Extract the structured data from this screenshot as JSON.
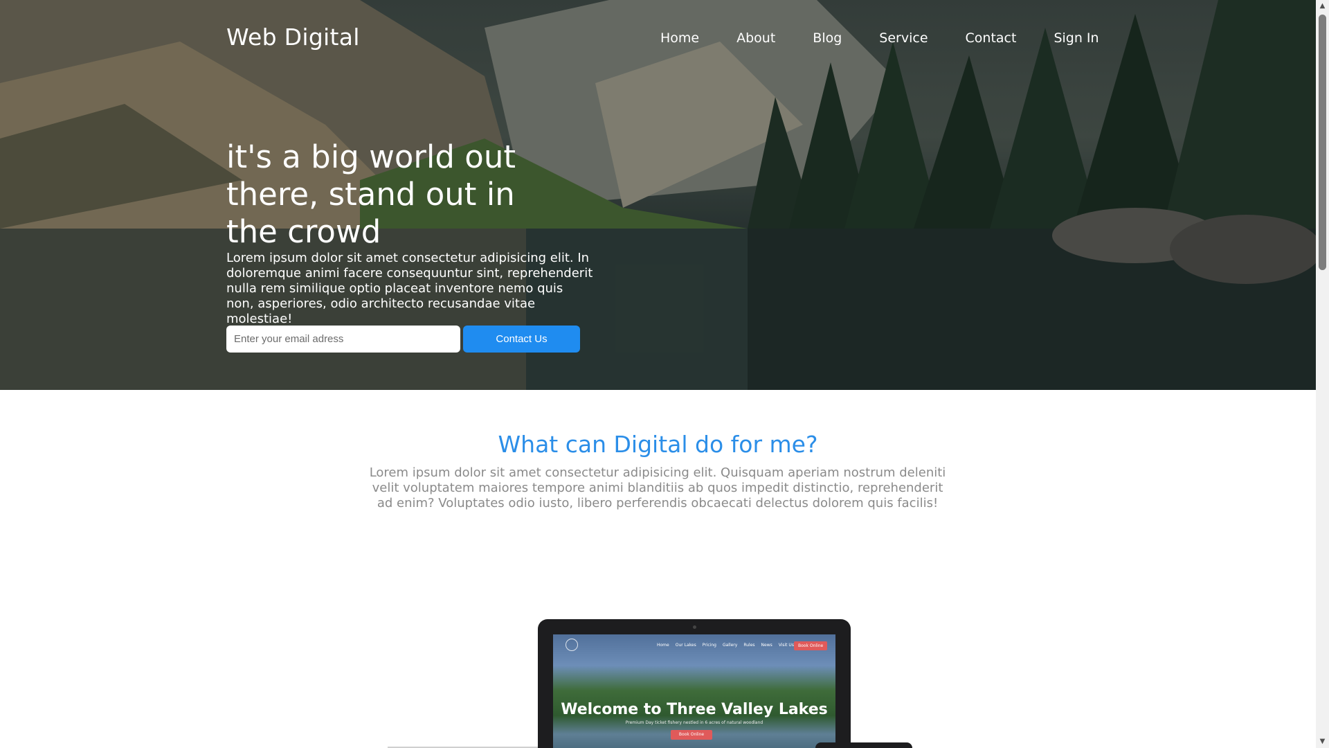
{
  "header": {
    "brand": "Web Digital",
    "nav": [
      "Home",
      "About",
      "Blog",
      "Service",
      "Contact",
      "Sign In"
    ]
  },
  "hero": {
    "title": "it's a big world out there, stand out in the crowd",
    "text": "Lorem ipsum dolor sit amet consectetur adipisicing elit. In doloremque animi facere consequuntur sint, reprehenderit nulla rem similique optio placeat inventore nemo quis non, asperiores, odio architecto recusandae vitae molestiae!",
    "email_placeholder": "Enter your email adress",
    "cta_label": "Contact Us"
  },
  "section": {
    "title": "What can Digital do for me?",
    "text": "Lorem ipsum dolor sit amet consectetur adipisicing elit. Quisquam aperiam nostrum deleniti velit voluptatem maiores tempore animi blanditiis ab quos impedit distinctio, reprehenderit ad enim? Voluptates odio iusto, libero perferendis obcaecati delectus dolorem quis facilis!"
  },
  "mockup": {
    "nav": [
      "Home",
      "Our Lakes",
      "Pricing",
      "Gallery",
      "Rules",
      "News",
      "Visit Us"
    ],
    "nav_cta": "Book Online",
    "title": "Welcome to Three Valley Lakes",
    "subtitle": "Premium Day ticket fishery nestled in 6 acres of natural woodland",
    "cta": "Book Online"
  },
  "colors": {
    "accent": "#1f8cf0",
    "section_title": "#2b8ee8",
    "mockup_cta": "#e05a5a"
  },
  "icons": {
    "scroll_up": "triangle-up",
    "scroll_down": "triangle-down"
  }
}
